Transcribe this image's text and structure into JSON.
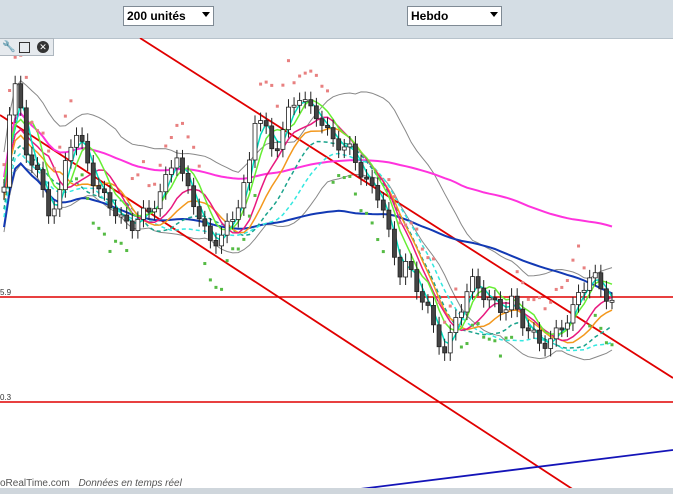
{
  "toolbar": {
    "period_select": "200 unités",
    "interval_select": "Hebdo"
  },
  "icons": [
    "wrench-icon",
    "window-icon",
    "close-icon"
  ],
  "footer": {
    "source": "oRealTime.com",
    "live_note": "Données en temps réel"
  },
  "axis_labels": {
    "upper_level": "5.9",
    "lower_level": "0.3"
  },
  "chart_data": {
    "type": "candlestick",
    "title": "",
    "xlabel": "",
    "ylabel": "",
    "candles_count": 110,
    "series": [
      {
        "kind": "price"
      },
      {
        "kind": "bollinger"
      },
      {
        "kind": "moving-average",
        "color": "#00e0c0"
      },
      {
        "kind": "moving-average",
        "color": "#66ee33"
      },
      {
        "kind": "moving-average",
        "color": "#e8197f"
      },
      {
        "kind": "moving-average",
        "color": "#f3981d"
      },
      {
        "kind": "moving-average",
        "color": "#1239b4"
      },
      {
        "kind": "moving-average",
        "color": "#ff33dd"
      },
      {
        "kind": "dashed-average",
        "color": "#1aa38c"
      },
      {
        "kind": "dashed-average",
        "color": "#33e8e0"
      },
      {
        "kind": "parabolic-sar"
      },
      {
        "kind": "horizontal-line",
        "color": "#e00000"
      },
      {
        "kind": "trend-line",
        "color": "#e00000"
      },
      {
        "kind": "trend-line",
        "color": "#1414b8"
      }
    ],
    "colors": {
      "up": "#ffffff",
      "down": "#444444",
      "sar_above": "#e88080",
      "sar_below": "#55bb44"
    },
    "grid": false,
    "legend": "none"
  }
}
